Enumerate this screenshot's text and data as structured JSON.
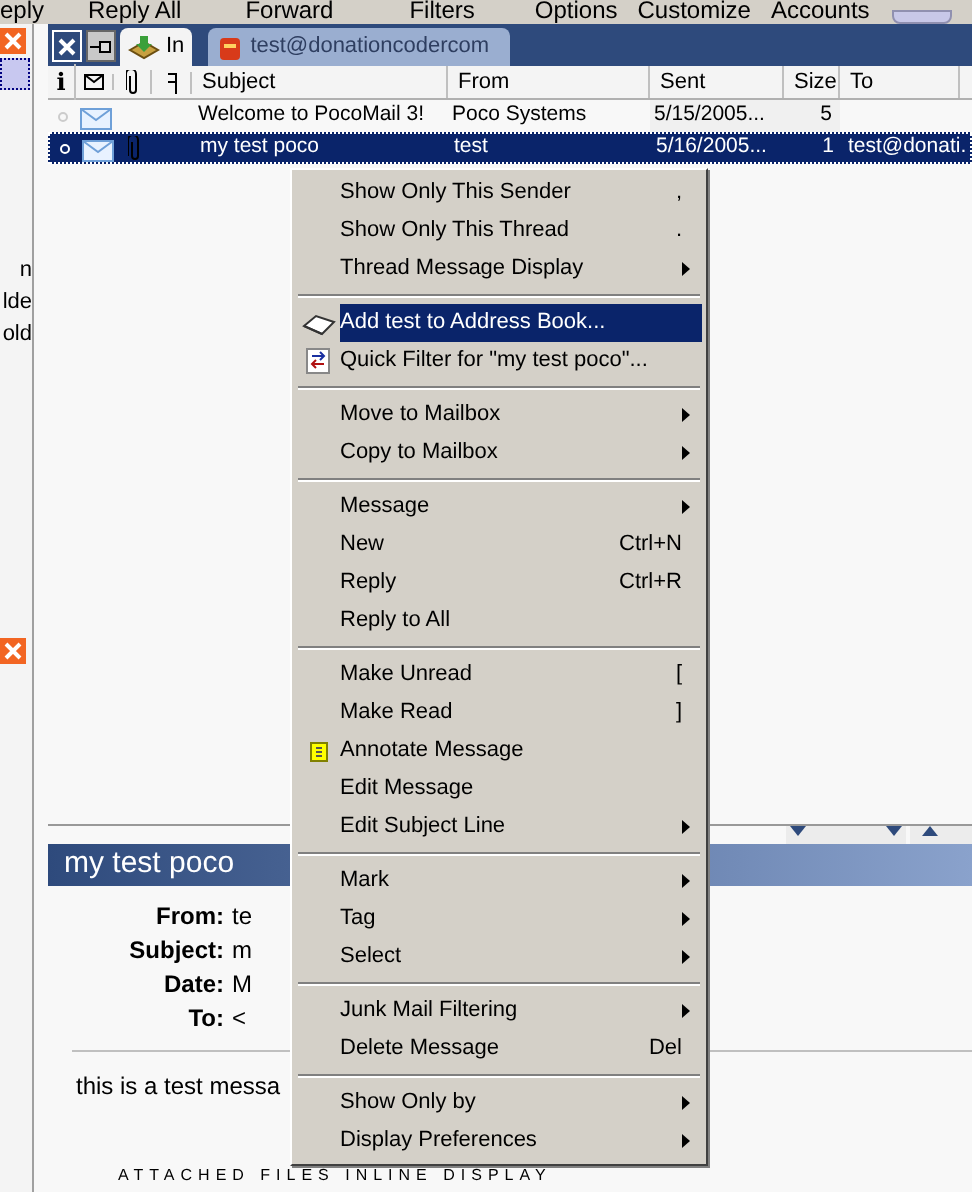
{
  "toolbar": {
    "buttons": [
      "eply",
      "Reply All",
      "Forward",
      "Filters",
      "Options",
      "Customize",
      "Accounts"
    ]
  },
  "left_panel": {
    "texts": [
      "n",
      "lde",
      "old"
    ]
  },
  "mailbox_tabs": [
    {
      "label": "In",
      "selected": true
    },
    {
      "label": "test@donationcodercom",
      "selected": false
    }
  ],
  "columns": {
    "info": "i",
    "subject": "Subject",
    "from": "From",
    "sent": "Sent",
    "size": "Size",
    "to": "To"
  },
  "rows": [
    {
      "selected": false,
      "attachment": false,
      "subject": "Welcome to PocoMail 3!",
      "from": "Poco Systems",
      "sent": "5/15/2005...",
      "size": "5",
      "to": ""
    },
    {
      "selected": true,
      "attachment": true,
      "subject": "my test poco",
      "from": "test",
      "sent": "5/16/2005...",
      "size": "1",
      "to": "test@donati."
    }
  ],
  "context_menu": [
    {
      "kind": "item",
      "label": "Show Only This Sender",
      "shortcut": ",",
      "submenu": false,
      "selected": false
    },
    {
      "kind": "item",
      "label": "Show Only This Thread",
      "shortcut": ".",
      "submenu": false,
      "selected": false
    },
    {
      "kind": "item",
      "label": "Thread Message Display",
      "submenu": true,
      "selected": false
    },
    {
      "kind": "separator"
    },
    {
      "kind": "contact",
      "label": "Add test to Address Book...",
      "submenu": false,
      "selected": true
    },
    {
      "kind": "filter",
      "label": "Quick Filter for \"my test poco\"...",
      "submenu": false,
      "selected": false
    },
    {
      "kind": "separator"
    },
    {
      "kind": "item",
      "label": "Move to Mailbox",
      "submenu": true,
      "selected": false
    },
    {
      "kind": "item",
      "label": "Copy to Mailbox",
      "submenu": true,
      "selected": false
    },
    {
      "kind": "separator"
    },
    {
      "kind": "item",
      "label": "Message",
      "submenu": true,
      "selected": false
    },
    {
      "kind": "item",
      "label": "New",
      "shortcut": "Ctrl+N",
      "submenu": false,
      "selected": false
    },
    {
      "kind": "item",
      "label": "Reply",
      "shortcut": "Ctrl+R",
      "submenu": false,
      "selected": false
    },
    {
      "kind": "item",
      "label": "Reply to All",
      "submenu": false,
      "selected": false
    },
    {
      "kind": "separator"
    },
    {
      "kind": "item",
      "label": "Make Unread",
      "shortcut": "[",
      "submenu": false,
      "selected": false
    },
    {
      "kind": "item",
      "label": "Make Read",
      "shortcut": "]",
      "submenu": false,
      "selected": false
    },
    {
      "kind": "note",
      "label": "Annotate Message",
      "submenu": false,
      "selected": false
    },
    {
      "kind": "item",
      "label": "Edit Message",
      "submenu": false,
      "selected": false
    },
    {
      "kind": "item",
      "label": "Edit Subject Line",
      "submenu": true,
      "selected": false
    },
    {
      "kind": "separator"
    },
    {
      "kind": "item",
      "label": "Mark",
      "submenu": true,
      "selected": false
    },
    {
      "kind": "item",
      "label": "Tag",
      "submenu": true,
      "selected": false
    },
    {
      "kind": "item",
      "label": "Select",
      "submenu": true,
      "selected": false
    },
    {
      "kind": "separator"
    },
    {
      "kind": "item",
      "label": "Junk Mail Filtering",
      "submenu": true,
      "selected": false
    },
    {
      "kind": "item",
      "label": "Delete Message",
      "shortcut": "Del",
      "submenu": false,
      "selected": false
    },
    {
      "kind": "separator"
    },
    {
      "kind": "item",
      "label": "Show Only by",
      "submenu": true,
      "selected": false
    },
    {
      "kind": "item",
      "label": "Display Preferences",
      "submenu": true,
      "selected": false
    }
  ],
  "preview": {
    "title": "my test poco",
    "fields": [
      {
        "label": "From:",
        "value": "te"
      },
      {
        "label": "Subject:",
        "value": "m"
      },
      {
        "label": "Date:",
        "value": "M"
      },
      {
        "label": "To:",
        "value": "<"
      }
    ],
    "body": "this is a test messa",
    "attachments_heading": "ATTACHED FILES INLINE DISPLAY"
  }
}
